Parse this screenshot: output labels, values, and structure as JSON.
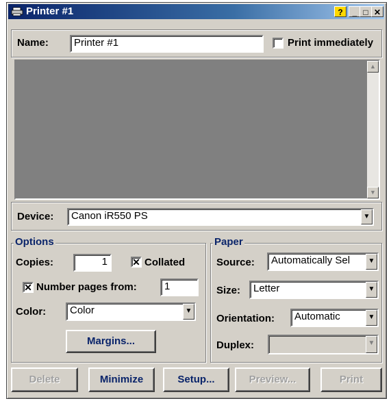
{
  "window": {
    "title": "Printer #1"
  },
  "name_row": {
    "label": "Name:",
    "value": "Printer #1",
    "print_immediately_label": "Print immediately",
    "print_immediately_checked": false
  },
  "device": {
    "label": "Device:",
    "value": "Canon iR550 PS"
  },
  "options": {
    "title": "Options",
    "copies_label": "Copies:",
    "copies_value": "1",
    "collated_label": "Collated",
    "collated_checked": true,
    "number_pages_label": "Number pages from:",
    "number_pages_checked": true,
    "number_pages_value": "1",
    "color_label": "Color:",
    "color_value": "Color",
    "margins_label": "Margins..."
  },
  "paper": {
    "title": "Paper",
    "source_label": "Source:",
    "source_value": "Automatically Sel",
    "size_label": "Size:",
    "size_value": "Letter",
    "orientation_label": "Orientation:",
    "orientation_value": "Automatic",
    "duplex_label": "Duplex:",
    "duplex_value": ""
  },
  "buttons": {
    "delete": "Delete",
    "minimize": "Minimize",
    "setup": "Setup...",
    "preview": "Preview...",
    "print": "Print"
  },
  "glyphs": {
    "check": "✕",
    "help": "?",
    "min": "_",
    "max": "□",
    "close": "✕",
    "down": "▼",
    "up": "▲"
  }
}
